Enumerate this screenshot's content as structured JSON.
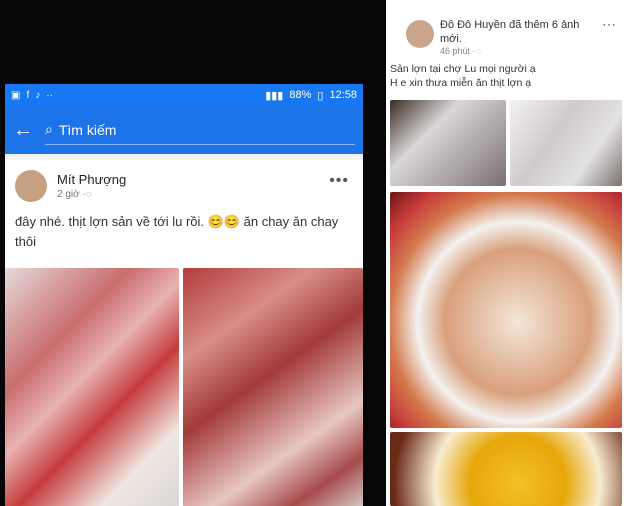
{
  "left_phone": {
    "status_bar": {
      "battery": "88%",
      "time": "12:58"
    },
    "search": {
      "back_icon": "back-arrow-icon",
      "search_icon": "search-icon",
      "label": "Tìm kiếm"
    },
    "post": {
      "author": "Mít Phượng",
      "time": "2 giờ",
      "text": "đây nhé. thịt lợn sản về tới lu rồi. 😊😊 ăn chay ăn chay thôi"
    }
  },
  "right_panel": {
    "post": {
      "author_line": "Đô Đô Huyền đã thêm 6 ảnh mới.",
      "time": "46 phút",
      "caption_lines": [
        "Sản lợn tại chợ Lu mọi người ạ",
        "H e xin thưa miễn ăn thịt lợn ạ"
      ]
    }
  }
}
